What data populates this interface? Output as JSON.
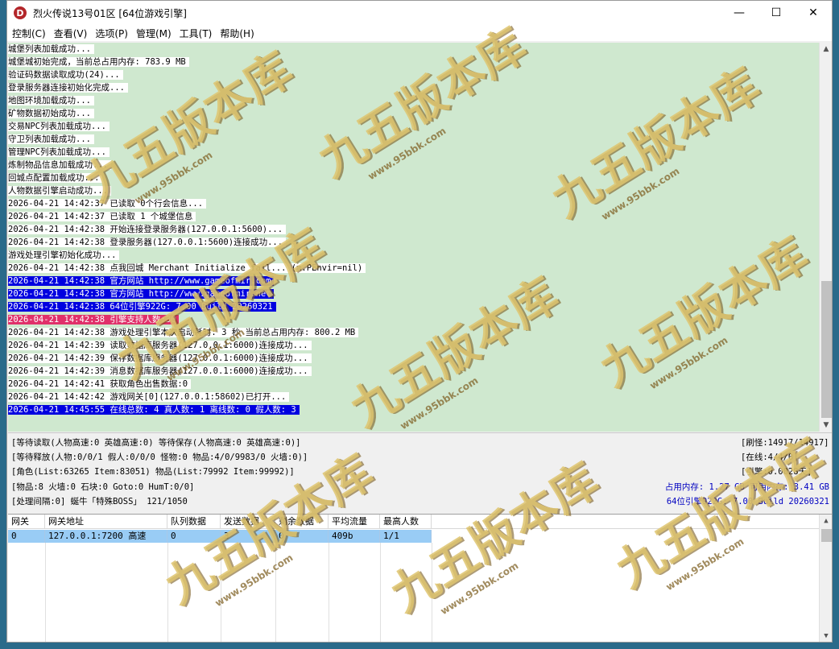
{
  "window": {
    "icon_letter": "D",
    "title": "烈火传说13号01区 [64位游戏引擎]",
    "minimize": "—",
    "maximize": "☐",
    "close": "✕"
  },
  "menu": [
    {
      "label": "控制(C)"
    },
    {
      "label": "查看(V)"
    },
    {
      "label": "选项(P)"
    },
    {
      "label": "管理(M)"
    },
    {
      "label": "工具(T)"
    },
    {
      "label": "帮助(H)"
    }
  ],
  "log": [
    {
      "text": "城堡列表加载成功..."
    },
    {
      "text": "城堡城初始完成，当前总占用内存: 783.9 MB"
    },
    {
      "text": "验证码数据读取成功(24)..."
    },
    {
      "text": "登录服务器连接初始化完成..."
    },
    {
      "text": "地图环境加载成功..."
    },
    {
      "text": "矿物数据初始成功..."
    },
    {
      "text": "交易NPC列表加载成功..."
    },
    {
      "text": "守卫列表加载成功..."
    },
    {
      "text": "管理NPC列表加载成功..."
    },
    {
      "text": "炼制物品信息加载成功..."
    },
    {
      "text": "回城点配置加载成功..."
    },
    {
      "text": "人物数据引擎启动成功..."
    },
    {
      "text": "2026-04-21 14:42:37 已读取 0个行会信息..."
    },
    {
      "text": "2026-04-21 14:42:37 已读取 1 个城堡信息"
    },
    {
      "text": "2026-04-21 14:42:38 开始连接登录服务器(127.0.0.1:5600)..."
    },
    {
      "text": "2026-04-21 14:42:38 登录服务器(127.0.0.1:5600)连接成功..."
    },
    {
      "text": "游戏处理引擎初始化成功..."
    },
    {
      "text": "2026-04-21 14:42:38 点我回城 Merchant Initialize fail... (m.PEnvir=nil)"
    },
    {
      "text": "2026-04-21 14:42:38 官方网站 http://www.gameofmir.com",
      "style": "blue"
    },
    {
      "text": "2026-04-21 14:42:38 官方网站 http://www.gameofmir.net",
      "style": "blue"
    },
    {
      "text": "2026-04-21 14:42:38 64位引擎922G: 7.00 Build 20260321",
      "style": "blue"
    },
    {
      "text": "2026-04-21 14:42:38 引擎支持人数:30",
      "style": "pink"
    },
    {
      "text": "2026-04-21 14:42:38 游戏处理引擎本次启动耗时: 3 秒 当前总占用内存: 800.2 MB"
    },
    {
      "text": "2026-04-21 14:42:39 读取数据库服务器(127.0.0.1:6000)连接成功..."
    },
    {
      "text": "2026-04-21 14:42:39 保存数据库服务器(127.0.0.1:6000)连接成功..."
    },
    {
      "text": "2026-04-21 14:42:39 消息数据库服务器(127.0.0.1:6000)连接成功..."
    },
    {
      "text": "2026-04-21 14:42:41 获取角色出售数据:0"
    },
    {
      "text": "2026-04-21 14:42:42 游戏网关[0](127.0.0.1:58602)已打开..."
    },
    {
      "text": "2026-04-21 14:45:55 在线总数: 4 真人数: 1 离线数: 0 假人数: 3",
      "style": "blue"
    }
  ],
  "status": {
    "line1": "[等待读取(人物高速:0 英雄高速:0) 等待保存(人物高速:0 英雄高速:0)]",
    "line2": "[等待释放(人物:0/0/1 假人:0/0/0 怪物:0 物品:4/0/9983/0 火墙:0)]",
    "line3": "[角色(List:63265 Item:83051) 物品(List:79992 Item:99992)]",
    "line4": "[物品:8 火墙:0 石块:0 Goto:0 HumT:0/0]",
    "line5": "[处理间隔:0]   蜒牛「特殊BOSS」 121/1050",
    "right1": "[刷怪:14917/14917]",
    "right2": "[在线:4/4/0]",
    "right3": "[引擎:0.0028天]",
    "memory": "占用内存: 1.27 GB 可用内存: 3.41 GB",
    "build": "64位引擎922G: 7.00 Build 20260321"
  },
  "grid": {
    "headers": [
      "网关",
      "网关地址",
      "队列数据",
      "发送数据",
      "剩余数据",
      "平均流量",
      "最高人数"
    ],
    "rows": [
      [
        "0",
        "127.0.0.1:7200 高速",
        "0",
        "3",
        "0",
        "409b",
        "1/1"
      ]
    ]
  },
  "watermark": {
    "main": "九五版本库",
    "sub": "www.95bbk.com"
  },
  "colors": {
    "log_bg": "#cfe8cf",
    "highlight_blue": "#0000e0",
    "highlight_pink": "#e0306a",
    "selected_row": "#99ccf5",
    "status_blue": "#0000c0"
  }
}
